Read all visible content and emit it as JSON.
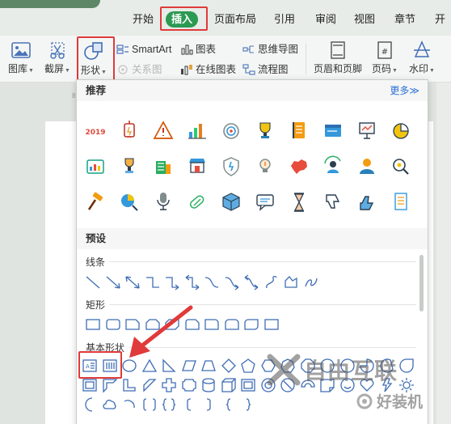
{
  "ribbon": {
    "tabs": [
      {
        "label": "开始"
      },
      {
        "label": "插入",
        "active": true
      },
      {
        "label": "页面布局"
      },
      {
        "label": "引用"
      },
      {
        "label": "审阅"
      },
      {
        "label": "视图"
      },
      {
        "label": "章节"
      },
      {
        "label": "开"
      }
    ],
    "accent_color": "#2b9a52",
    "highlight_color": "#e03a3a"
  },
  "toolbar": {
    "picture": "图库",
    "screenshot": "截屏",
    "shapes": "形状",
    "smartart": "SmartArt",
    "relation_chart": "关系图",
    "chart": "图表",
    "online_chart": "在线图表",
    "mindmap": "思维导图",
    "flowchart": "流程图",
    "header_footer": "页眉和页脚",
    "page_number": "页码",
    "watermark": "水印"
  },
  "ruler": {
    "mark": "8"
  },
  "shapes_panel": {
    "recommended_title": "推荐",
    "more_label": "更多≫",
    "recommended_icons": [
      "calendar-2019-icon",
      "lantern-icon",
      "warning-icon",
      "bar-chart-icon",
      "target-icon",
      "trophy-icon",
      "notebook-icon",
      "window-icon",
      "presentation-icon",
      "pie-chart-icon",
      "dashboard-icon",
      "cup-icon",
      "building-icon",
      "shop-icon",
      "shield-icon",
      "lightbulb-icon",
      "china-map-icon",
      "person-refresh-icon",
      "user-icon",
      "search-gear-icon",
      "hammer-icon",
      "pie-search-icon",
      "microphone-icon",
      "pill-icon",
      "cube-icon",
      "chat-icon",
      "hourglass-icon",
      "thumbs-down-icon",
      "thumbs-up-icon",
      "document-icon"
    ],
    "presets_title": "预设",
    "lines_label": "线条",
    "rectangles_label": "矩形",
    "basic_shapes_label": "基本形状",
    "textbox_icons": [
      "horizontal-textbox-icon",
      "vertical-textbox-icon"
    ],
    "watermark_text": "自由互联",
    "watermark2_text": "好装机"
  }
}
